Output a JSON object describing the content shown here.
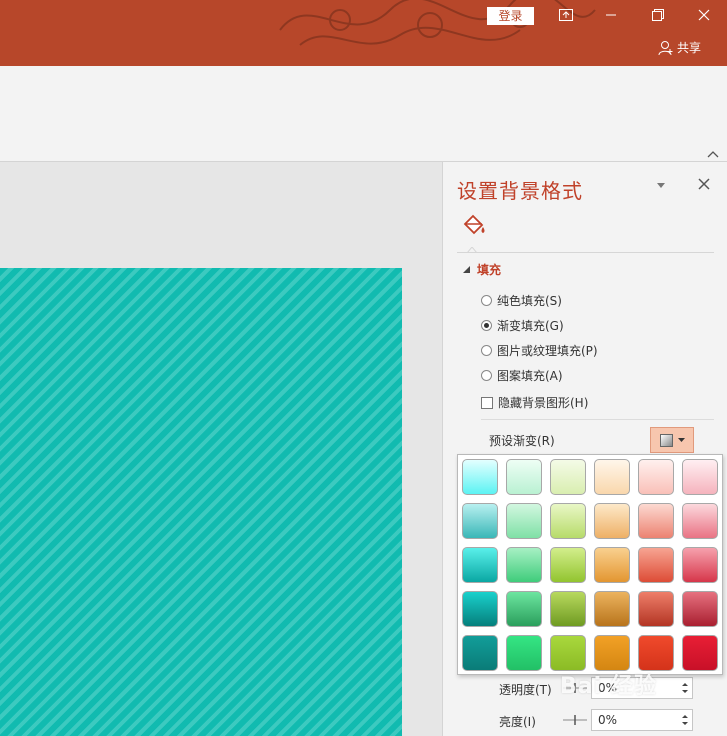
{
  "titlebar": {
    "login_label": "登录",
    "share_label": "共享",
    "bg_color": "#b7472a"
  },
  "pane": {
    "title": "设置背景格式",
    "section_fill": "填充",
    "options": [
      {
        "label": "纯色填充(S)",
        "selected": false
      },
      {
        "label": "渐变填充(G)",
        "selected": true
      },
      {
        "label": "图片或纹理填充(P)",
        "selected": false
      },
      {
        "label": "图案填充(A)",
        "selected": false
      }
    ],
    "hide_bg_label": "隐藏背景图形(H)",
    "preset_label": "预设渐变(R)",
    "transparency_label": "透明度(T)",
    "transparency_value": "0%",
    "brightness_label": "亮度(I)",
    "brightness_value": "0%"
  },
  "gradient_presets": {
    "rows": [
      [
        {
          "top": "#e3ffff",
          "bottom": "#5cf3f3"
        },
        {
          "top": "#eefef5",
          "bottom": "#b9f1d2"
        },
        {
          "top": "#f4fbe7",
          "bottom": "#d9eeb0"
        },
        {
          "top": "#fff6ea",
          "bottom": "#f9d7ac"
        },
        {
          "top": "#fff0ee",
          "bottom": "#f9c0b8"
        },
        {
          "top": "#ffeff2",
          "bottom": "#f5b3bd"
        }
      ],
      [
        {
          "top": "#b8f0f0",
          "bottom": "#3ab7b7"
        },
        {
          "top": "#d2f7e0",
          "bottom": "#7fe0a6"
        },
        {
          "top": "#e9f7c6",
          "bottom": "#b7db6a"
        },
        {
          "top": "#fde9c9",
          "bottom": "#eeb066"
        },
        {
          "top": "#fcd9d1",
          "bottom": "#ec8271"
        },
        {
          "top": "#fcd8dd",
          "bottom": "#e97384"
        }
      ],
      [
        {
          "top": "#59f0ea",
          "bottom": "#0aa7a3"
        },
        {
          "top": "#a7f0c4",
          "bottom": "#3fcc7b"
        },
        {
          "top": "#d3ee8c",
          "bottom": "#92c42f"
        },
        {
          "top": "#f9d08f",
          "bottom": "#e39631"
        },
        {
          "top": "#f7a492",
          "bottom": "#dd4c36"
        },
        {
          "top": "#f6a1ad",
          "bottom": "#d6364a"
        }
      ],
      [
        {
          "top": "#1ad1cc",
          "bottom": "#057f7c"
        },
        {
          "top": "#6de5a0",
          "bottom": "#2a9f5c"
        },
        {
          "top": "#b8d95e",
          "bottom": "#6f9b22"
        },
        {
          "top": "#ecb35e",
          "bottom": "#b8741c"
        },
        {
          "top": "#ee7e69",
          "bottom": "#b33524"
        },
        {
          "top": "#e6717f",
          "bottom": "#a91f30"
        }
      ],
      [
        {
          "top": "#129d99",
          "bottom": "#0a7c78"
        },
        {
          "top": "#35e584",
          "bottom": "#22c066"
        },
        {
          "top": "#a9d83d",
          "bottom": "#8bbb25"
        },
        {
          "top": "#f2a126",
          "bottom": "#d48612"
        },
        {
          "top": "#f04a2c",
          "bottom": "#d4331a"
        },
        {
          "top": "#e81f35",
          "bottom": "#c81028"
        }
      ]
    ]
  },
  "colors": {
    "accent": "#c0422a",
    "slide_stripe_a": "#11bbb0",
    "slide_stripe_b": "#3ccac0"
  },
  "icons": [
    "restore-ribbon-icon",
    "minimize-icon",
    "restore-icon",
    "close-icon",
    "person-icon",
    "paint-bucket-icon",
    "collapse-ribbon-icon"
  ]
}
